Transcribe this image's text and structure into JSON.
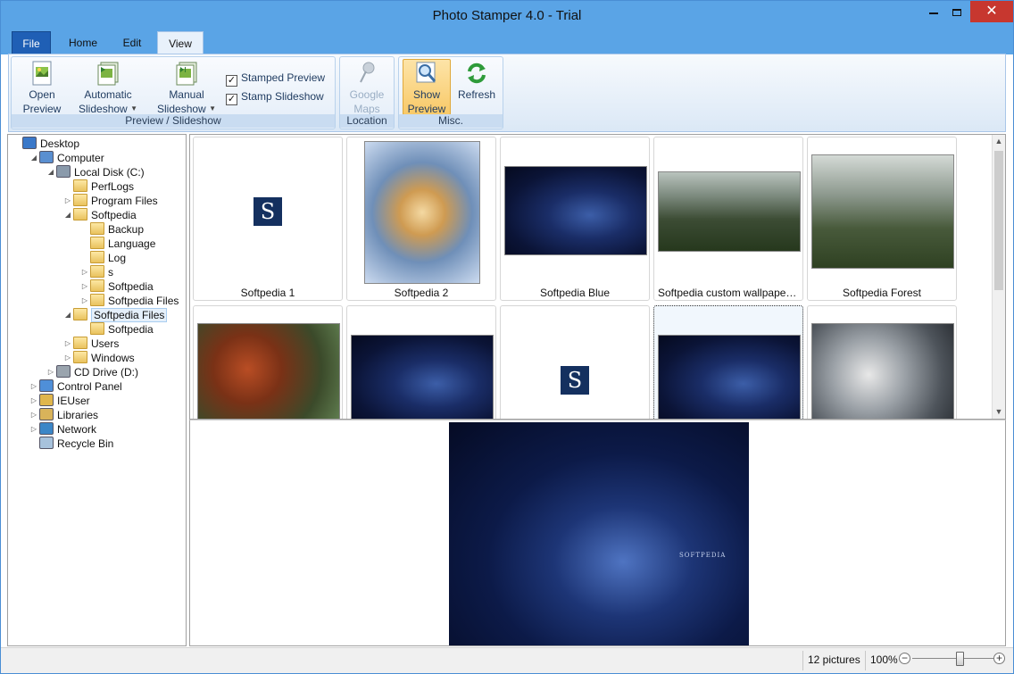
{
  "window": {
    "title": "Photo Stamper 4.0 - Trial",
    "close_glyph": "✕"
  },
  "tabs": {
    "file": "File",
    "home": "Home",
    "edit": "Edit",
    "view": "View"
  },
  "ribbon": {
    "preview_group": {
      "label": "Preview / Slideshow",
      "open_preview": [
        "Open",
        "Preview"
      ],
      "automatic_slideshow": [
        "Automatic",
        "Slideshow"
      ],
      "manual_slideshow": [
        "Manual",
        "Slideshow"
      ],
      "stamped_preview": {
        "label": "Stamped Preview",
        "checked": true
      },
      "stamp_slideshow": {
        "label": "Stamp Slideshow",
        "checked": true
      }
    },
    "location_group": {
      "label": "Location",
      "google_maps": [
        "Google",
        "Maps"
      ]
    },
    "misc_group": {
      "label": "Misc.",
      "show_preview": [
        "Show",
        "Preview"
      ],
      "refresh": "Refresh"
    }
  },
  "tree": [
    {
      "label": "Desktop",
      "icon": "desktop-icon",
      "arrow": ""
    },
    {
      "label": "Computer",
      "icon": "computer-icon",
      "arrow": "◢"
    },
    {
      "label": "Local Disk (C:)",
      "icon": "drive-icon",
      "arrow": "◢"
    },
    {
      "label": "PerfLogs",
      "icon": "folder-icon",
      "arrow": ""
    },
    {
      "label": "Program Files",
      "icon": "folder-icon",
      "arrow": "▷"
    },
    {
      "label": "Softpedia",
      "icon": "folder-icon",
      "arrow": "◢"
    },
    {
      "label": "Backup",
      "icon": "folder-icon",
      "arrow": ""
    },
    {
      "label": "Language",
      "icon": "folder-icon",
      "arrow": ""
    },
    {
      "label": "Log",
      "icon": "folder-icon",
      "arrow": ""
    },
    {
      "label": "s",
      "icon": "folder-icon",
      "arrow": "▷"
    },
    {
      "label": "Softpedia",
      "icon": "folder-icon",
      "arrow": "▷"
    },
    {
      "label": "Softpedia Files",
      "icon": "folder-icon",
      "arrow": "▷"
    },
    {
      "label": "Softpedia Files",
      "icon": "folder-icon",
      "arrow": "◢",
      "selected": true
    },
    {
      "label": "Softpedia",
      "icon": "folder-icon",
      "arrow": ""
    },
    {
      "label": "Users",
      "icon": "folder-icon",
      "arrow": "▷"
    },
    {
      "label": "Windows",
      "icon": "folder-icon",
      "arrow": "▷"
    },
    {
      "label": "CD Drive (D:)",
      "icon": "cd-drive-icon",
      "arrow": "▷"
    },
    {
      "label": "Control Panel",
      "icon": "control-panel-icon",
      "arrow": "▷"
    },
    {
      "label": "IEUser",
      "icon": "user-folder-icon",
      "arrow": "▷"
    },
    {
      "label": "Libraries",
      "icon": "libraries-icon",
      "arrow": "▷"
    },
    {
      "label": "Network",
      "icon": "network-icon",
      "arrow": "▷"
    },
    {
      "label": "Recycle Bin",
      "icon": "recycle-bin-icon",
      "arrow": ""
    }
  ],
  "thumbnails": [
    {
      "caption": "Softpedia 1",
      "kind": "s-icon"
    },
    {
      "caption": "Softpedia 2",
      "kind": "s-art"
    },
    {
      "caption": "Softpedia Blue",
      "kind": "blue"
    },
    {
      "caption": "Softpedia custom wallpaper wi...",
      "kind": "forest"
    },
    {
      "caption": "Softpedia Forest",
      "kind": "forest2"
    },
    {
      "caption": "",
      "kind": "leaves"
    },
    {
      "caption": "",
      "kind": "blue"
    },
    {
      "caption": "",
      "kind": "s-icon"
    },
    {
      "caption": "",
      "kind": "blue"
    },
    {
      "caption": "",
      "kind": "frost"
    }
  ],
  "preview": {
    "watermark": "SOFTPEDIA"
  },
  "status": {
    "picture_count": "12 pictures",
    "zoom": "100%",
    "zoom_level": 0.58
  }
}
